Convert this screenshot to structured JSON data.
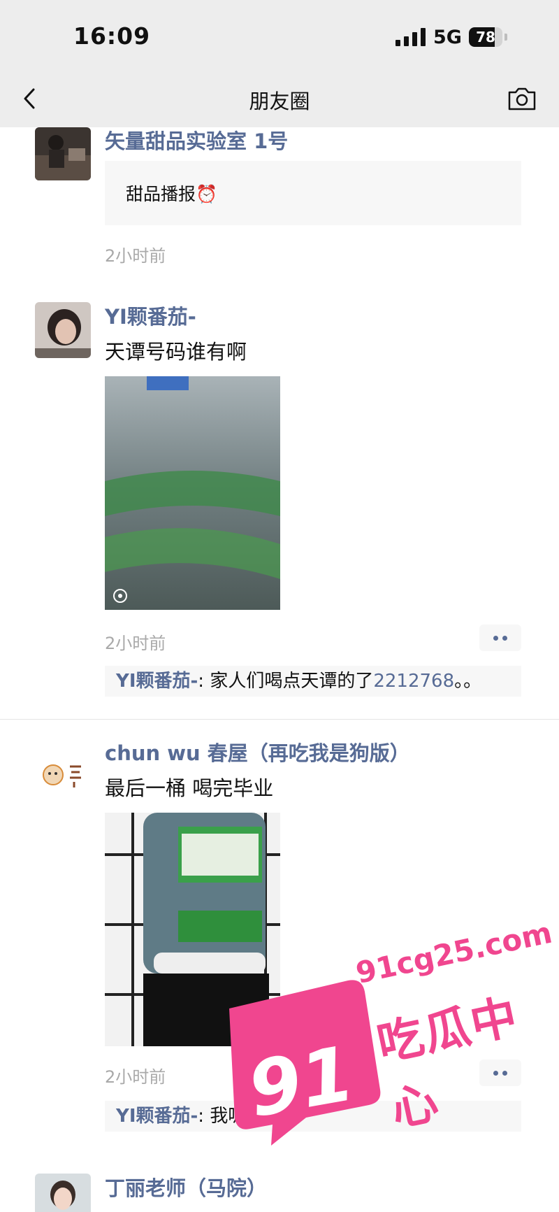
{
  "status_bar": {
    "time": "16:09",
    "network": "5G",
    "battery": "78",
    "battery_level": 0.78
  },
  "nav": {
    "title": "朋友圈",
    "back_icon": "chevron-left-icon",
    "camera_icon": "camera-icon"
  },
  "posts": [
    {
      "author": "矢量甜品实验室 1号",
      "share_title": "甜品播报⏰",
      "time": "2小时前"
    },
    {
      "author": "YI颗番茄-",
      "text": "天谭号码谁有啊",
      "time": "2小时前",
      "comments": [
        {
          "name": "YI颗番茄-",
          "sep": ": ",
          "text": "家人们喝点天谭的了",
          "number": "2212768",
          "tail": "。。"
        }
      ]
    },
    {
      "author": "chun wu 春屋（再吃我是狗版）",
      "text": "最后一桶 喝完毕业",
      "time": "2小时前",
      "comments": [
        {
          "name": "YI颗番茄-",
          "sep": ": ",
          "text": "我呢也是"
        }
      ]
    },
    {
      "author": "丁丽老师（马院）"
    }
  ],
  "watermark": {
    "number": "91",
    "url": "91cg25.com",
    "text": "吃瓜中心"
  },
  "colors": {
    "link": "#576b95",
    "bar": "#ededed",
    "watermark": "#f0468f"
  }
}
